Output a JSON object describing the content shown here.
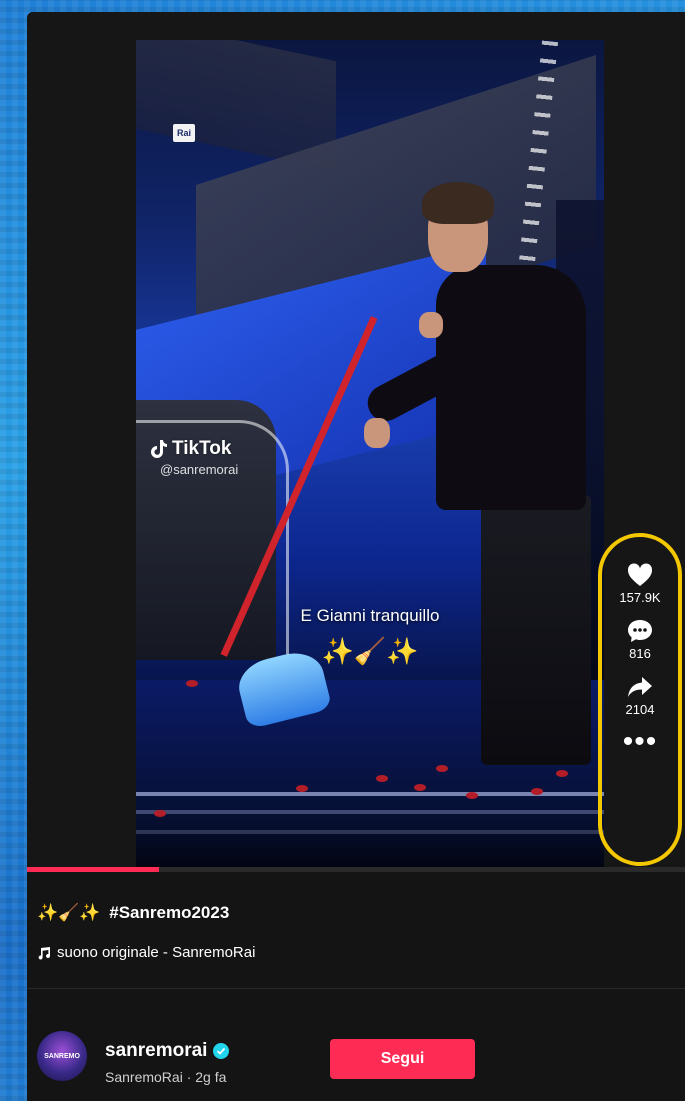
{
  "video": {
    "watermark_brand": "TikTok",
    "watermark_handle": "@sanremorai",
    "broadcaster_logo": "Rai",
    "overlay_caption": "E Gianni tranquillo",
    "overlay_emoji": "✨🧹✨",
    "progress_fraction": 0.2
  },
  "actions": {
    "like_icon": "heart-icon",
    "likes": "157.9K",
    "comment_icon": "comment-icon",
    "comments": "816",
    "share_icon": "share-icon",
    "shares": "2104",
    "more_icon": "more-icon",
    "more_label": "•••"
  },
  "post": {
    "desc_emoji": "✨🧹✨",
    "hashtag": "#Sanremo2023",
    "sound": "suono originale - SanremoRai"
  },
  "author": {
    "avatar_text": "SANREMO",
    "username": "sanremorai",
    "display_line": "SanremoRai · 2g fa",
    "follow_label": "Segui"
  },
  "colors": {
    "accent": "#fe2c55",
    "highlight_border": "#f4c800",
    "verified": "#20d5ec"
  }
}
